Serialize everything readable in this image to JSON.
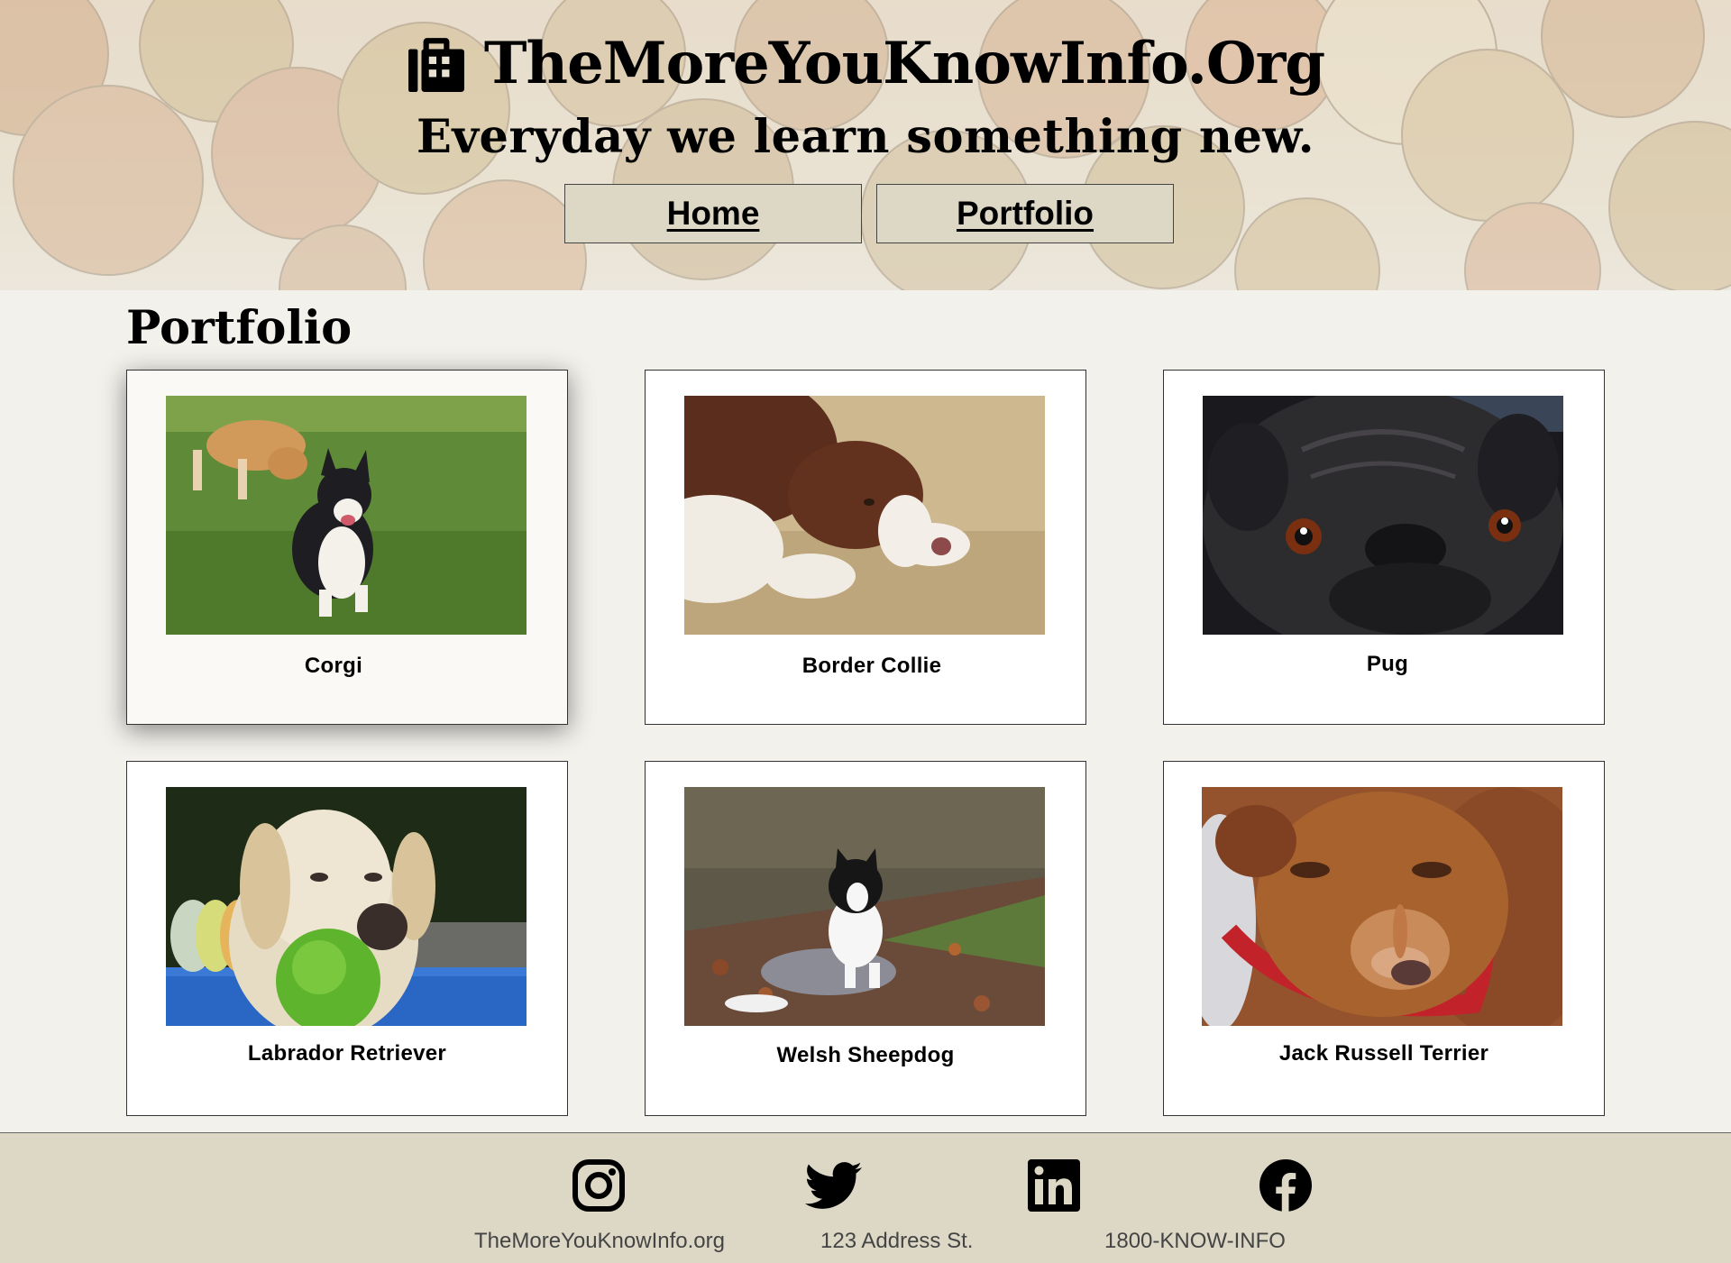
{
  "site": {
    "title": "TheMoreYouKnowInfo.Org",
    "tagline": "Everyday we learn something new.",
    "icon": "building-icon"
  },
  "nav": [
    {
      "label": "Home"
    },
    {
      "label": "Portfolio"
    }
  ],
  "page_title": "Portfolio",
  "cards": [
    {
      "label": "Corgi",
      "photo": "corgi-photo"
    },
    {
      "label": "Border Collie",
      "photo": "border-collie-photo"
    },
    {
      "label": "Pug",
      "photo": "pug-photo"
    },
    {
      "label": "Labrador Retriever",
      "photo": "labrador-photo"
    },
    {
      "label": "Welsh Sheepdog",
      "photo": "welsh-sheepdog-photo"
    },
    {
      "label": "Jack Russell Terrier",
      "photo": "jack-russell-photo"
    }
  ],
  "footer": {
    "social": [
      "instagram-icon",
      "twitter-icon",
      "linkedin-icon",
      "facebook-icon"
    ],
    "website": "TheMoreYouKnowInfo.org",
    "address": "123 Address St.",
    "phone": "1800-KNOW-INFO"
  },
  "colors": {
    "page_bg": "#f3f1ec",
    "nav_button_bg": "#ddd8c6",
    "footer_bg": "#ddd8c6"
  }
}
